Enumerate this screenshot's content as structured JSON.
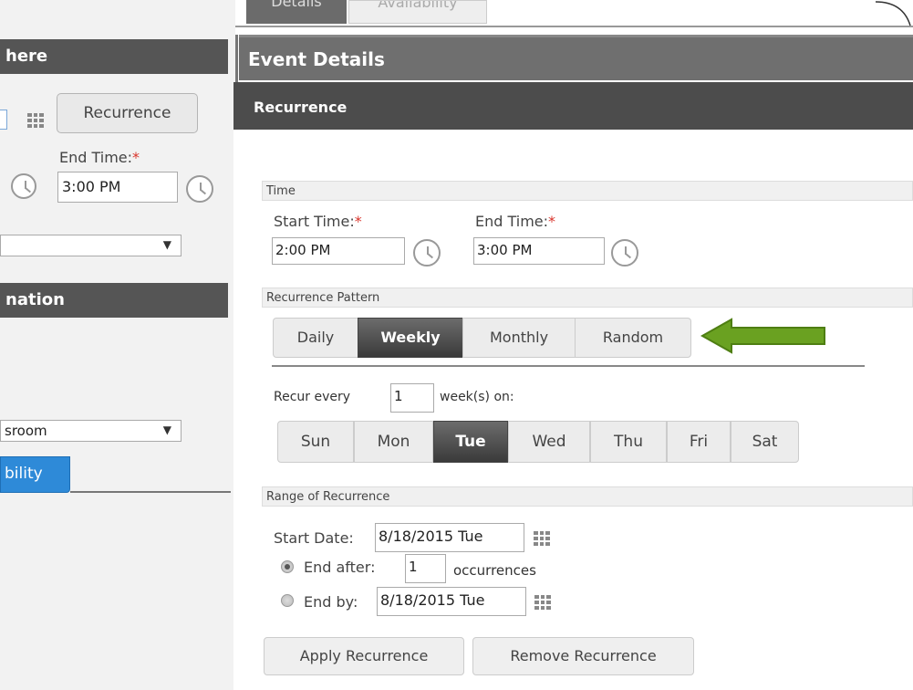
{
  "left_panel": {
    "where_header": "here",
    "info_header": "nation",
    "recurrence_button": "Recurrence",
    "end_time_label": "End Time:",
    "required_mark": "*",
    "end_time_value": "3:00 PM",
    "select_1_value": "",
    "select_2_value": "sroom",
    "availability_tab": "bility"
  },
  "tabs": {
    "details": "Details",
    "availability": "Availability"
  },
  "event_details_title": "Event Details",
  "recurrence_title": "Recurrence",
  "time_section": {
    "title": "Time",
    "start_label": "Start Time:",
    "start_value": "2:00 PM",
    "end_label": "End Time:",
    "end_value": "3:00 PM",
    "required_mark": "*"
  },
  "pattern_section": {
    "title": "Recurrence Pattern",
    "options": [
      "Daily",
      "Weekly",
      "Monthly",
      "Random"
    ],
    "selected": "Weekly",
    "recur_every_label": "Recur every",
    "recur_every_value": "1",
    "recur_suffix": "week(s) on:",
    "days": [
      "Sun",
      "Mon",
      "Tue",
      "Wed",
      "Thu",
      "Fri",
      "Sat"
    ],
    "selected_day": "Tue"
  },
  "range_section": {
    "title": "Range of Recurrence",
    "start_date_label": "Start Date:",
    "start_date_value": "8/18/2015 Tue",
    "end_after_label": "End after:",
    "end_after_value": "1",
    "occurrences_label": "occurrences",
    "end_by_label": "End by:",
    "end_by_value": "8/18/2015 Tue",
    "end_after_checked": true
  },
  "buttons": {
    "apply": "Apply Recurrence",
    "remove": "Remove Recurrence"
  },
  "colors": {
    "arrow": "#6aa121",
    "active_segment": "#3a3a3a",
    "availability_tab": "#2e8ad8"
  }
}
